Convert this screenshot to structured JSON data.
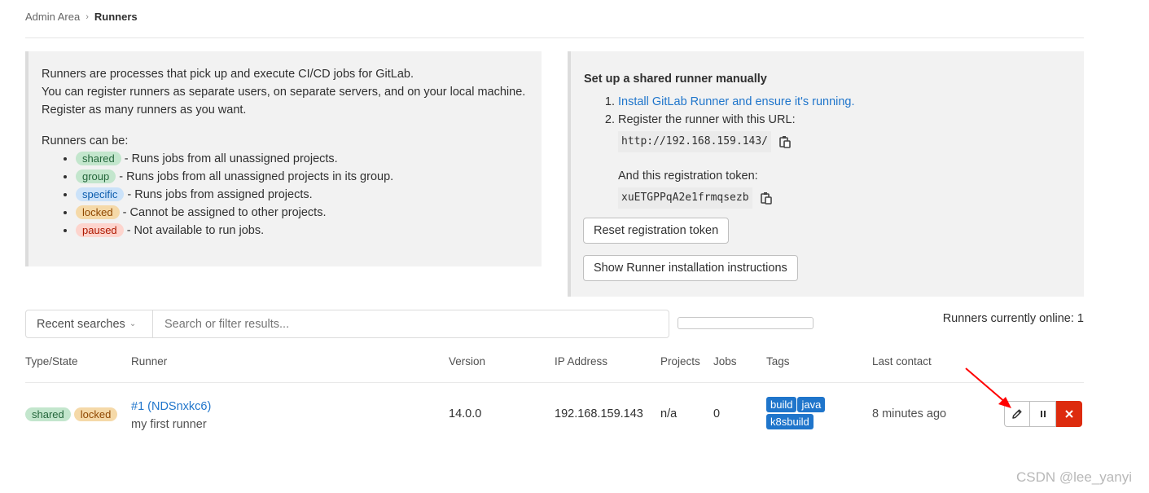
{
  "breadcrumb": {
    "parent": "Admin Area",
    "current": "Runners"
  },
  "intro": {
    "line1": "Runners are processes that pick up and execute CI/CD jobs for GitLab.",
    "line2": "You can register runners as separate users, on separate servers, and on your local machine.",
    "line3": "Register as many runners as you want.",
    "can_be": "Runners can be:",
    "types": [
      {
        "badge": "shared",
        "desc": "- Runs jobs from all unassigned projects."
      },
      {
        "badge": "group",
        "desc": "- Runs jobs from all unassigned projects in its group."
      },
      {
        "badge": "specific",
        "desc": "- Runs jobs from assigned projects."
      },
      {
        "badge": "locked",
        "desc": "- Cannot be assigned to other projects."
      },
      {
        "badge": "paused",
        "desc": "- Not available to run jobs."
      }
    ]
  },
  "setup": {
    "title": "Set up a shared runner manually",
    "step1_link": "Install GitLab Runner and ensure it's running.",
    "step2": "Register the runner with this URL:",
    "url": "http://192.168.159.143/",
    "token_label": "And this registration token:",
    "token": "xuETGPPqA2e1frmqsezb",
    "reset_button": "Reset registration token",
    "show_button": "Show Runner installation instructions"
  },
  "filter": {
    "recent_label": "Recent searches",
    "search_placeholder": "Search or filter results..."
  },
  "online": "Runners currently online: 1",
  "table": {
    "headers": [
      "Type/State",
      "Runner",
      "Version",
      "IP Address",
      "Projects",
      "Jobs",
      "Tags",
      "Last contact"
    ],
    "rows": [
      {
        "badges": [
          "shared",
          "locked"
        ],
        "runner_link": "#1 (NDSnxkc6)",
        "description": "my first runner",
        "version": "14.0.0",
        "ip": "192.168.159.143",
        "projects": "n/a",
        "jobs": "0",
        "tags": [
          "build",
          "java",
          "k8sbuild"
        ],
        "last_contact": "8 minutes ago"
      }
    ]
  },
  "watermark": "CSDN @lee_yanyi",
  "icons": [
    "chevron-right-icon",
    "copy-icon",
    "chevron-down-icon",
    "pencil-icon",
    "pause-icon",
    "close-icon",
    "arrow-annotation-icon"
  ],
  "colors": {
    "link": "#1f75cb",
    "tag": "#1f75cb",
    "danger": "#dd2b0e",
    "annotation": "#ff0000"
  }
}
